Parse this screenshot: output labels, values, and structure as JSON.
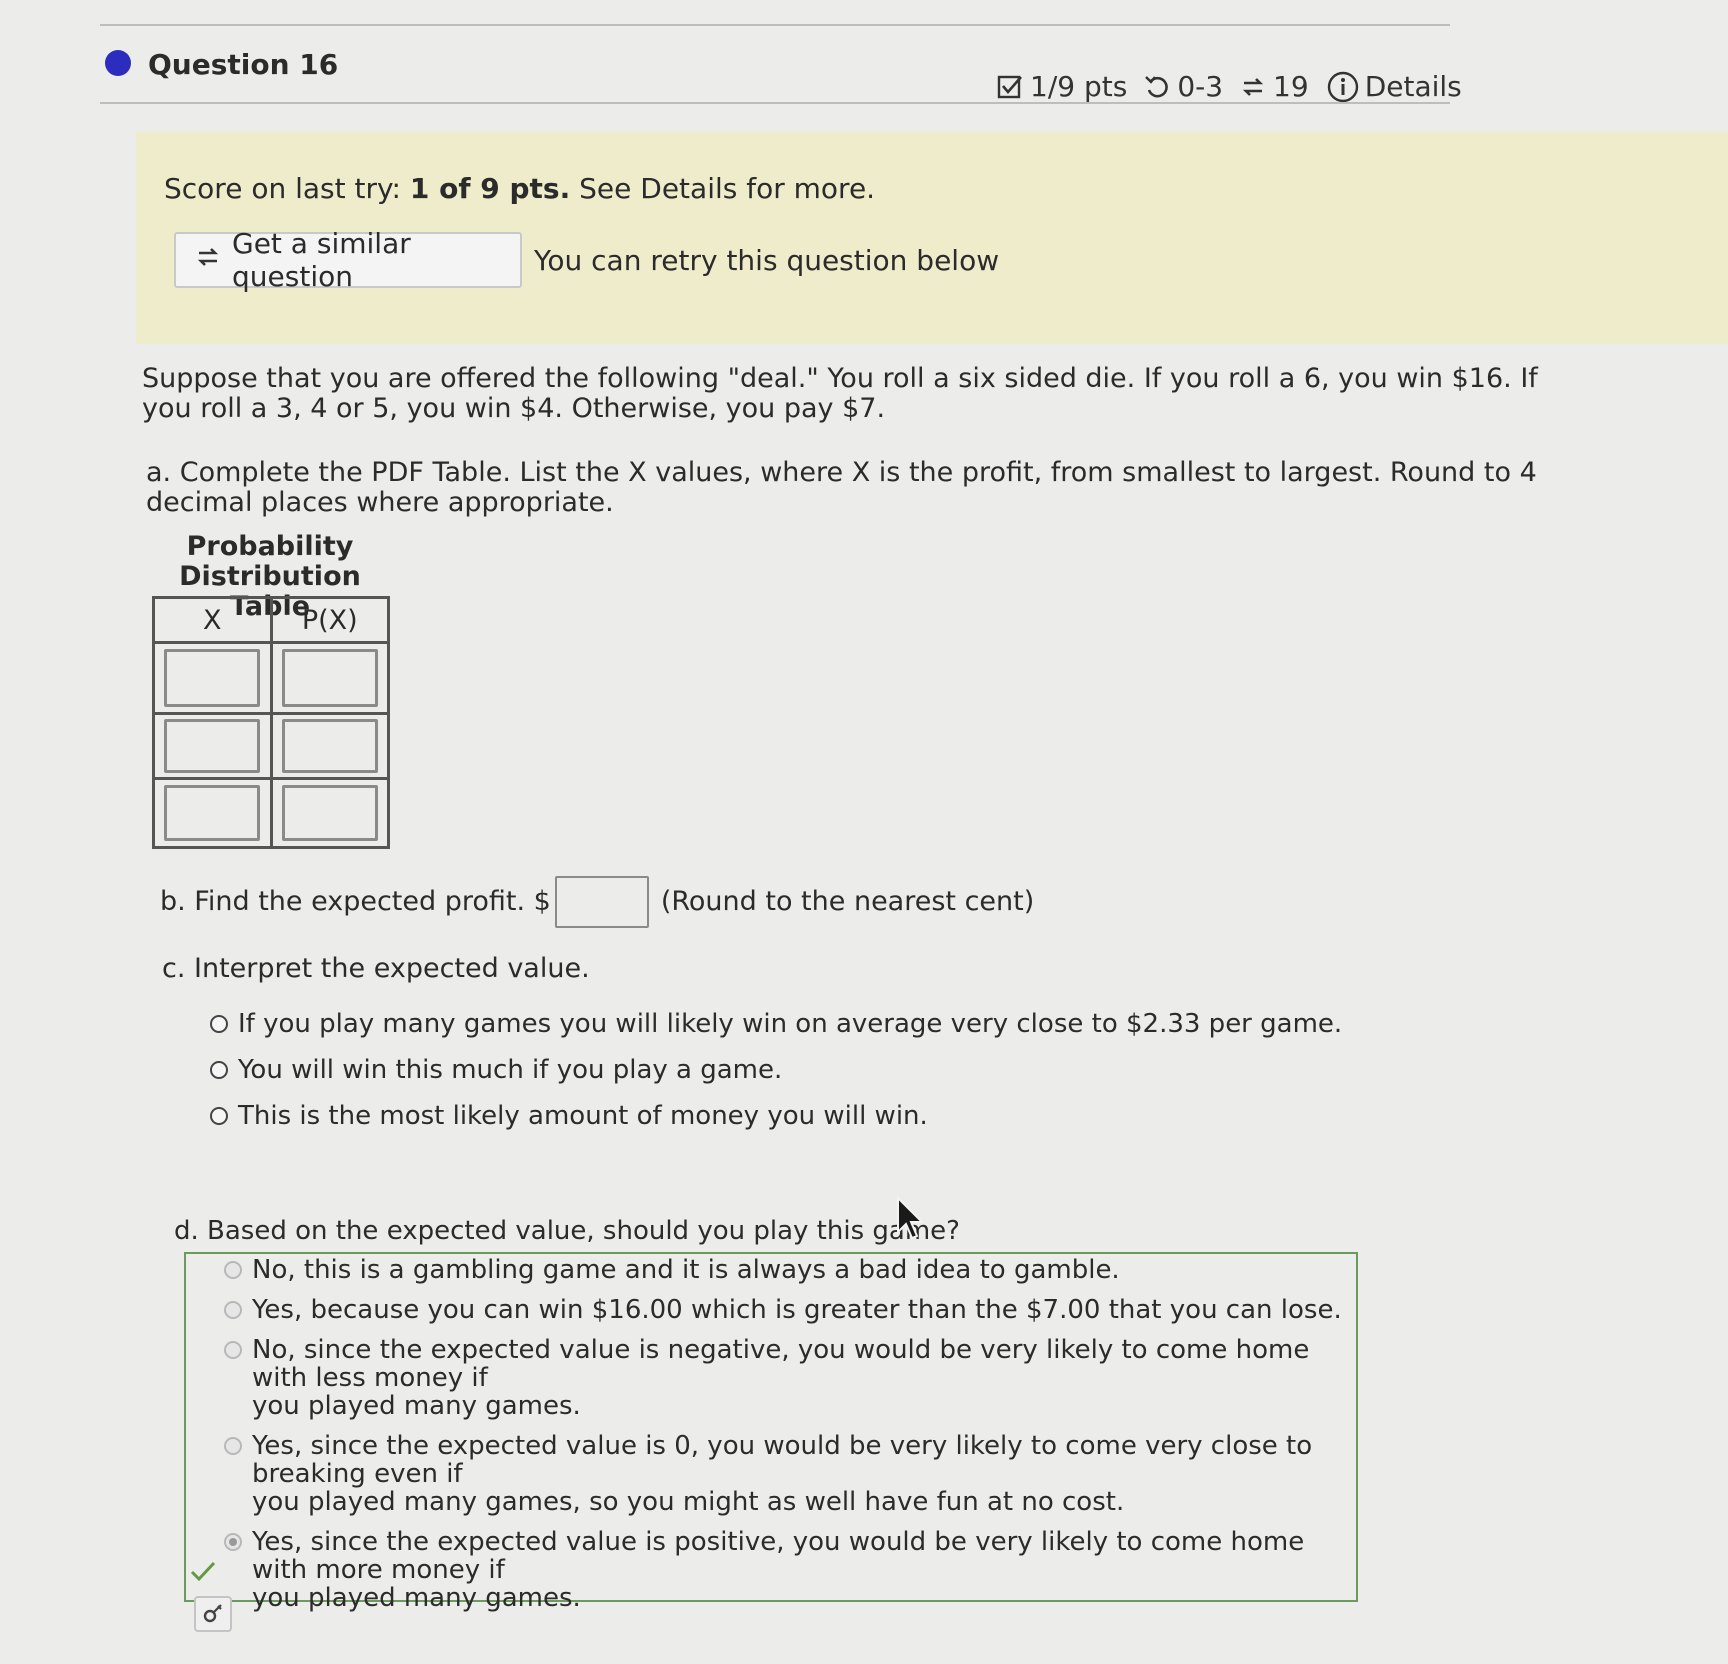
{
  "header": {
    "question_title": "Question 16",
    "score_pts": "1/9 pts",
    "attempts": "0-3",
    "versions": "19",
    "details_label": "Details"
  },
  "banner": {
    "score_prefix": "Score on last try:",
    "score_bold": "1 of 9 pts.",
    "score_suffix": "See Details for more.",
    "similar_button": "Get a similar question",
    "retry_text": "You can retry this question below"
  },
  "question": {
    "intro_line1": "Suppose that you are offered the following \"deal.\" You roll a six sided die. If you roll a 6, you win $16. If",
    "intro_line2": "you roll a 3, 4 or 5, you win $4. Otherwise, you pay $7.",
    "part_a_line1": "a. Complete the PDF Table. List the X values, where X is the profit, from smallest to largest. Round to 4",
    "part_a_line2": "decimal places where appropriate.",
    "table_caption_line1": "Probability",
    "table_caption_line2": "Distribution Table",
    "table_headers": [
      "X",
      "P(X)"
    ],
    "table_rows": [
      [
        "",
        ""
      ],
      [
        "",
        ""
      ],
      [
        "",
        ""
      ]
    ],
    "part_b_label": "b. Find the expected profit. $",
    "part_b_value": "",
    "part_b_hint": "(Round to the nearest cent)",
    "part_c_label": "c. Interpret the expected value.",
    "part_c_options": [
      "If you play many games you will likely win on average very close to $2.33 per game.",
      "You will win this much if you play a game.",
      "This is the most likely amount of money you will win."
    ],
    "part_d_label": "d. Based on the expected value, should you play this game?",
    "part_d_options": [
      {
        "line1": "No, this is a gambling game and it is always a bad idea to gamble.",
        "line2": ""
      },
      {
        "line1": "Yes, because you can win $16.00 which is greater than the $7.00 that you can lose.",
        "line2": ""
      },
      {
        "line1": "No, since the expected value is negative, you would be very likely to come home with less money if",
        "line2": "you played many games."
      },
      {
        "line1": "Yes, since the expected value is 0, you would be very likely to come very close to breaking even if",
        "line2": "you played many games, so you might as well have fun at no cost."
      },
      {
        "line1": "Yes, since the expected value is positive, you would be very likely to come home with more money if",
        "line2": "you played many games."
      }
    ],
    "part_d_selected_index": 4
  },
  "colors": {
    "accent_dot": "#2c2dbe",
    "banner_bg": "#efeccb",
    "correct_green": "#6a9b5c"
  }
}
